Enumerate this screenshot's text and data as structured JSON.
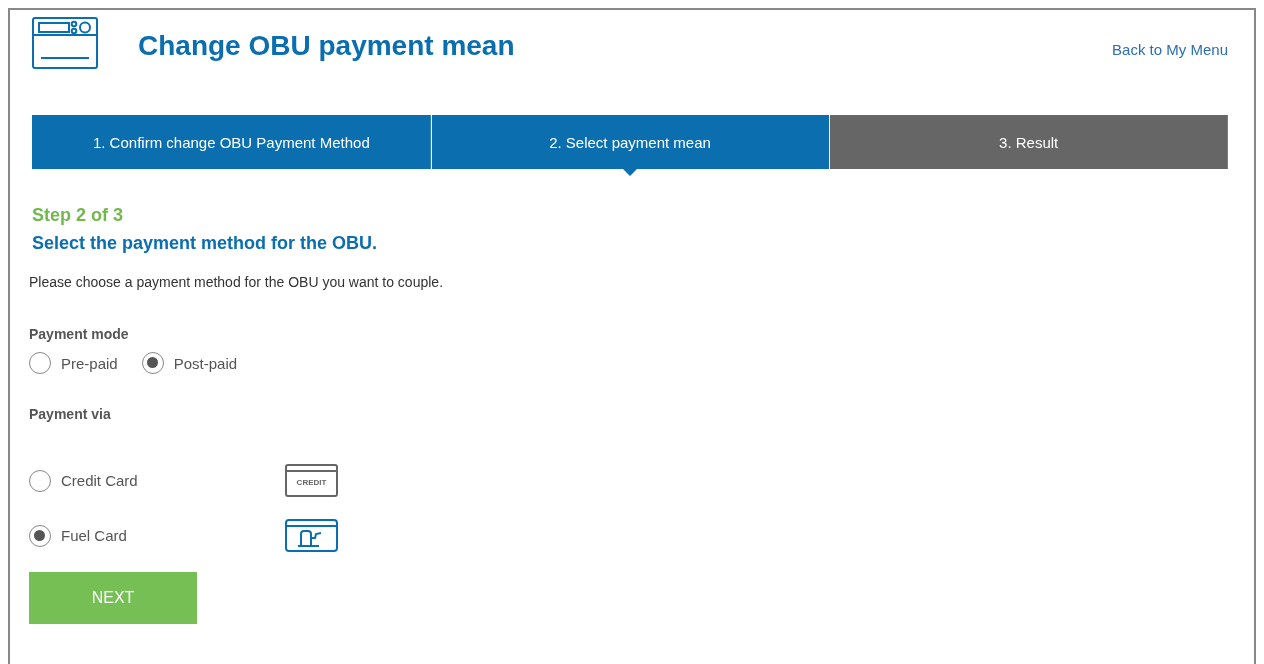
{
  "header": {
    "title": "Change OBU payment mean",
    "back_link": "Back to My Menu"
  },
  "steps": [
    {
      "label": "1. Confirm change OBU Payment Method",
      "selected": false,
      "done": true
    },
    {
      "label": "2. Select payment mean",
      "selected": true,
      "done": true
    },
    {
      "label": "3. Result",
      "selected": false,
      "done": false
    }
  ],
  "step_indicator": "Step 2 of 3",
  "heading": "Select the payment method for the OBU.",
  "description": "Please choose a payment method for the OBU you want to couple.",
  "payment_mode": {
    "label": "Payment mode",
    "options": [
      {
        "label": "Pre-paid",
        "selected": false
      },
      {
        "label": "Post-paid",
        "selected": true
      }
    ]
  },
  "payment_via": {
    "label": "Payment via",
    "options": [
      {
        "label": "Credit Card",
        "selected": false,
        "kind": "credit",
        "icon_text": "CREDIT"
      },
      {
        "label": "Fuel Card",
        "selected": true,
        "kind": "fuel"
      }
    ]
  },
  "next_button": "NEXT"
}
